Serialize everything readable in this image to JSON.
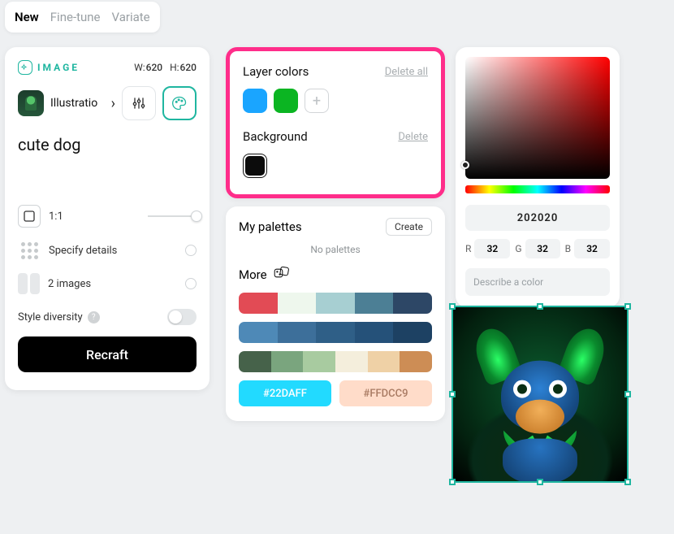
{
  "tabs": {
    "new": "New",
    "finetune": "Fine-tune",
    "variate": "Variate"
  },
  "left": {
    "mode_label": "IMAGE",
    "width_label": "W:",
    "width": "620",
    "height_label": "H:",
    "height": "620",
    "category": "Illustratio",
    "prompt": "cute dog",
    "aspect_label": "1:1",
    "specify_label": "Specify details",
    "images_label": "2 images",
    "style_diversity_label": "Style diversity",
    "recraft_label": "Recraft"
  },
  "mid": {
    "layer_colors_title": "Layer colors",
    "delete_all": "Delete all",
    "background_title": "Background",
    "delete": "Delete",
    "my_palettes_title": "My palettes",
    "create_label": "Create",
    "no_palettes": "No palettes",
    "more_title": "More",
    "layer_swatches": [
      "#1aa5ff",
      "#0bb522"
    ],
    "background_swatch": "#0c0c0c",
    "palettes": [
      [
        "#e24b55",
        "#eef7ed",
        "#a7cfd2",
        "#4c7f95",
        "#2d4766"
      ],
      [
        "#4e89b7",
        "#3d6f9a",
        "#2f5f87",
        "#255179",
        "#1d4163"
      ],
      [
        "#46624a",
        "#7aa57e",
        "#a8cba0",
        "#f4eedc",
        "#efd1a6",
        "#cd8d55"
      ]
    ],
    "chip_a": "#22DAFF",
    "chip_b": "#FFDCC9"
  },
  "picker": {
    "hex": "202020",
    "r_label": "R",
    "r": "32",
    "g_label": "G",
    "g": "32",
    "b_label": "B",
    "b": "32",
    "describe_placeholder": "Describe a color"
  }
}
